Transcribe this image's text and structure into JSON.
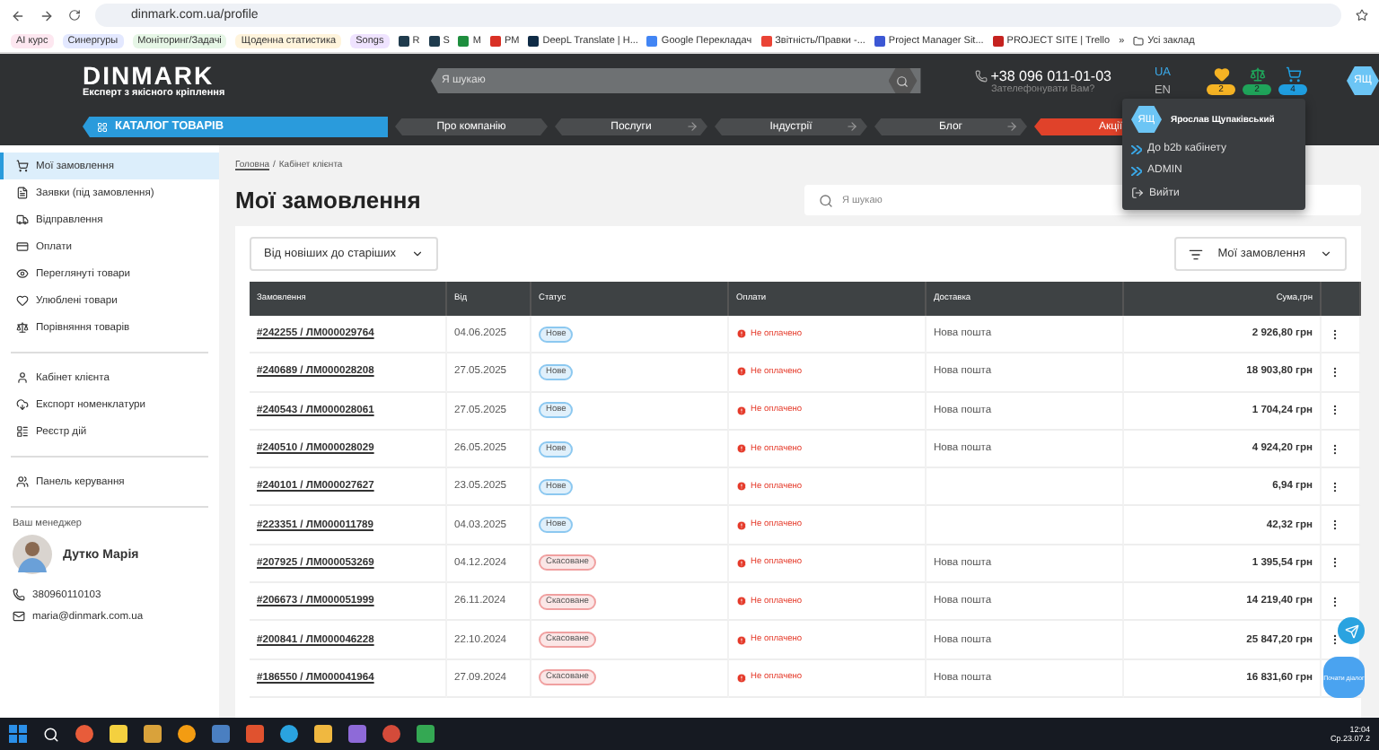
{
  "browser": {
    "url": "dinmark.com.ua/profile",
    "bookmarks": [
      {
        "label": "AI курс",
        "kind": "chip",
        "color": "#fde7f0"
      },
      {
        "label": "Синергуры",
        "kind": "chip",
        "color": "#e3e8ff"
      },
      {
        "label": "Моніторинг/Задачі",
        "kind": "chip",
        "color": "#e6f6e6"
      },
      {
        "label": "Щоденна статистика",
        "kind": "chip",
        "color": "#fff4dc"
      },
      {
        "label": "Songs",
        "kind": "chip",
        "color": "#efe3ff"
      },
      {
        "label": "R",
        "kind": "link",
        "color": "#1f3b4d"
      },
      {
        "label": "S",
        "kind": "link",
        "color": "#1f3b4d"
      },
      {
        "label": "M",
        "kind": "link",
        "color": "#1e8e3e"
      },
      {
        "label": "PM",
        "kind": "link",
        "color": "#d93025"
      },
      {
        "label": "DeepL Translate | H...",
        "kind": "link",
        "color": "#0f2b46"
      },
      {
        "label": "Google Перекладач",
        "kind": "link",
        "color": "#4285f4"
      },
      {
        "label": "Звітність/Правки -...",
        "kind": "link",
        "color": "#ea4335"
      },
      {
        "label": "Project Manager Sit...",
        "kind": "link",
        "color": "#3c57d4"
      },
      {
        "label": "PROJECT SITE | Trello",
        "kind": "link",
        "color": "#c5221f"
      }
    ],
    "more": "»",
    "all_bookmarks": "Усі заклад"
  },
  "header": {
    "logo": "DINMARK",
    "tagline": "Експерт з якісного кріплення",
    "search_placeholder": "Я шукаю",
    "phone": "+38 096 011-01-03",
    "callback": "Зателефонувати Вам?",
    "languages": [
      {
        "label": "UA",
        "selected": true
      },
      {
        "label": "EN",
        "selected": false
      }
    ],
    "counters": [
      {
        "kind": "favorites",
        "count": "2",
        "color": "#f5b324"
      },
      {
        "kind": "compare",
        "count": "2",
        "color": "#1fa45a"
      },
      {
        "kind": "cart",
        "count": "4",
        "color": "#1f9ee0"
      }
    ],
    "avatar": "ЯЩ"
  },
  "nav": {
    "catalog": "КАТАЛОГ ТОВАРІВ",
    "items": [
      {
        "label": "Про компанію",
        "kind": "plain"
      },
      {
        "label": "Послуги",
        "kind": "arrow"
      },
      {
        "label": "Індустрії",
        "kind": "arrow"
      },
      {
        "label": "Блог",
        "kind": "arrow"
      },
      {
        "label": "Акції",
        "kind": "promo"
      }
    ]
  },
  "user_menu": {
    "avatar": "ЯЩ",
    "name": "Ярослав Щупаківський",
    "items": [
      {
        "label": "До b2b кабінету",
        "kind": "b2b"
      },
      {
        "label": "ADMIN",
        "kind": "admin"
      },
      {
        "label": "Вийти",
        "kind": "logout"
      }
    ]
  },
  "sidebar": {
    "groups": [
      [
        {
          "label": "Мої замовлення",
          "kind": "orders",
          "selected": true
        },
        {
          "label": "Заявки (під замовлення)",
          "kind": "requests",
          "selected": false
        },
        {
          "label": "Відправлення",
          "kind": "shipping",
          "selected": false
        },
        {
          "label": "Оплати",
          "kind": "payments",
          "selected": false
        },
        {
          "label": "Переглянуті товари",
          "kind": "viewed",
          "selected": false
        },
        {
          "label": "Улюблені товари",
          "kind": "favorites",
          "selected": false
        },
        {
          "label": "Порівняння товарів",
          "kind": "compare",
          "selected": false
        }
      ],
      [
        {
          "label": "Кабінет клієнта",
          "kind": "client",
          "selected": false
        },
        {
          "label": "Експорт номенклатури",
          "kind": "export",
          "selected": false
        },
        {
          "label": "Реєстр дій",
          "kind": "log",
          "selected": false
        }
      ],
      [
        {
          "label": "Панель керування",
          "kind": "panel",
          "selected": false
        }
      ]
    ],
    "manager": {
      "label": "Ваш менеджер",
      "name": "Дутко Марія",
      "phone": "380960110103",
      "email": "maria@dinmark.com.ua"
    }
  },
  "main": {
    "breadcrumbs": [
      "Головна",
      "Кабінет клієнта"
    ],
    "breadcrumb_separator": "/",
    "title": "Мої замовлення",
    "search_placeholder": "Я шукаю",
    "sort": "Від новіших до старіших",
    "filter": "Мої замовлення",
    "table": {
      "columns": [
        "Замовлення",
        "Від",
        "Статус",
        "Оплати",
        "Доставка",
        "Сума,грн"
      ],
      "rows": [
        {
          "order": "#242255 / ЛМ000029764",
          "date": "04.06.2025",
          "status": {
            "label": "Нове",
            "color": "#8cc8f0"
          },
          "payment": "Не оплачено",
          "delivery": "Нова пошта",
          "sum": "2 926,80 грн"
        },
        {
          "order": "#240689 / ЛМ000028208",
          "date": "27.05.2025",
          "status": {
            "label": "Нове",
            "color": "#8cc8f0"
          },
          "payment": "Не оплачено",
          "delivery": "Нова пошта",
          "sum": "18 903,80 грн"
        },
        {
          "order": "#240543 / ЛМ000028061",
          "date": "27.05.2025",
          "status": {
            "label": "Нове",
            "color": "#8cc8f0"
          },
          "payment": "Не оплачено",
          "delivery": "Нова пошта",
          "sum": "1 704,24 грн"
        },
        {
          "order": "#240510 / ЛМ000028029",
          "date": "26.05.2025",
          "status": {
            "label": "Нове",
            "color": "#8cc8f0"
          },
          "payment": "Не оплачено",
          "delivery": "Нова пошта",
          "sum": "4 924,20 грн"
        },
        {
          "order": "#240101 / ЛМ000027627",
          "date": "23.05.2025",
          "status": {
            "label": "Нове",
            "color": "#8cc8f0"
          },
          "payment": "Не оплачено",
          "sum": "6,94 грн"
        },
        {
          "order": "#223351 / ЛМ000011789",
          "date": "04.03.2025",
          "status": {
            "label": "Нове",
            "color": "#8cc8f0"
          },
          "payment": "Не оплачено",
          "sum": "42,32 грн"
        },
        {
          "order": "#207925 / ЛМ000053269",
          "date": "04.12.2024",
          "status": {
            "label": "Скасоване",
            "color": "#f0a0a0"
          },
          "payment": "Не оплачено",
          "delivery": "Нова пошта",
          "sum": "1 395,54 грн"
        },
        {
          "order": "#206673 / ЛМ000051999",
          "date": "26.11.2024",
          "status": {
            "label": "Скасоване",
            "color": "#f0a0a0"
          },
          "payment": "Не оплачено",
          "delivery": "Нова пошта",
          "sum": "14 219,40 грн"
        },
        {
          "order": "#200841 / ЛМ000046228",
          "date": "22.10.2024",
          "status": {
            "label": "Скасоване",
            "color": "#f0a0a0"
          },
          "payment": "Не оплачено",
          "delivery": "Нова пошта",
          "sum": "25 847,20 грн"
        },
        {
          "order": "#186550 / ЛМ000041964",
          "date": "27.09.2024",
          "status": {
            "label": "Скасоване",
            "color": "#f0a0a0"
          },
          "payment": "Не оплачено",
          "delivery": "Нова пошта",
          "sum": "16 831,60 грн"
        }
      ]
    }
  },
  "chat_button": "Почати діалог",
  "taskbar": {
    "time": "12:04",
    "date": "Ср.23.07.2"
  }
}
